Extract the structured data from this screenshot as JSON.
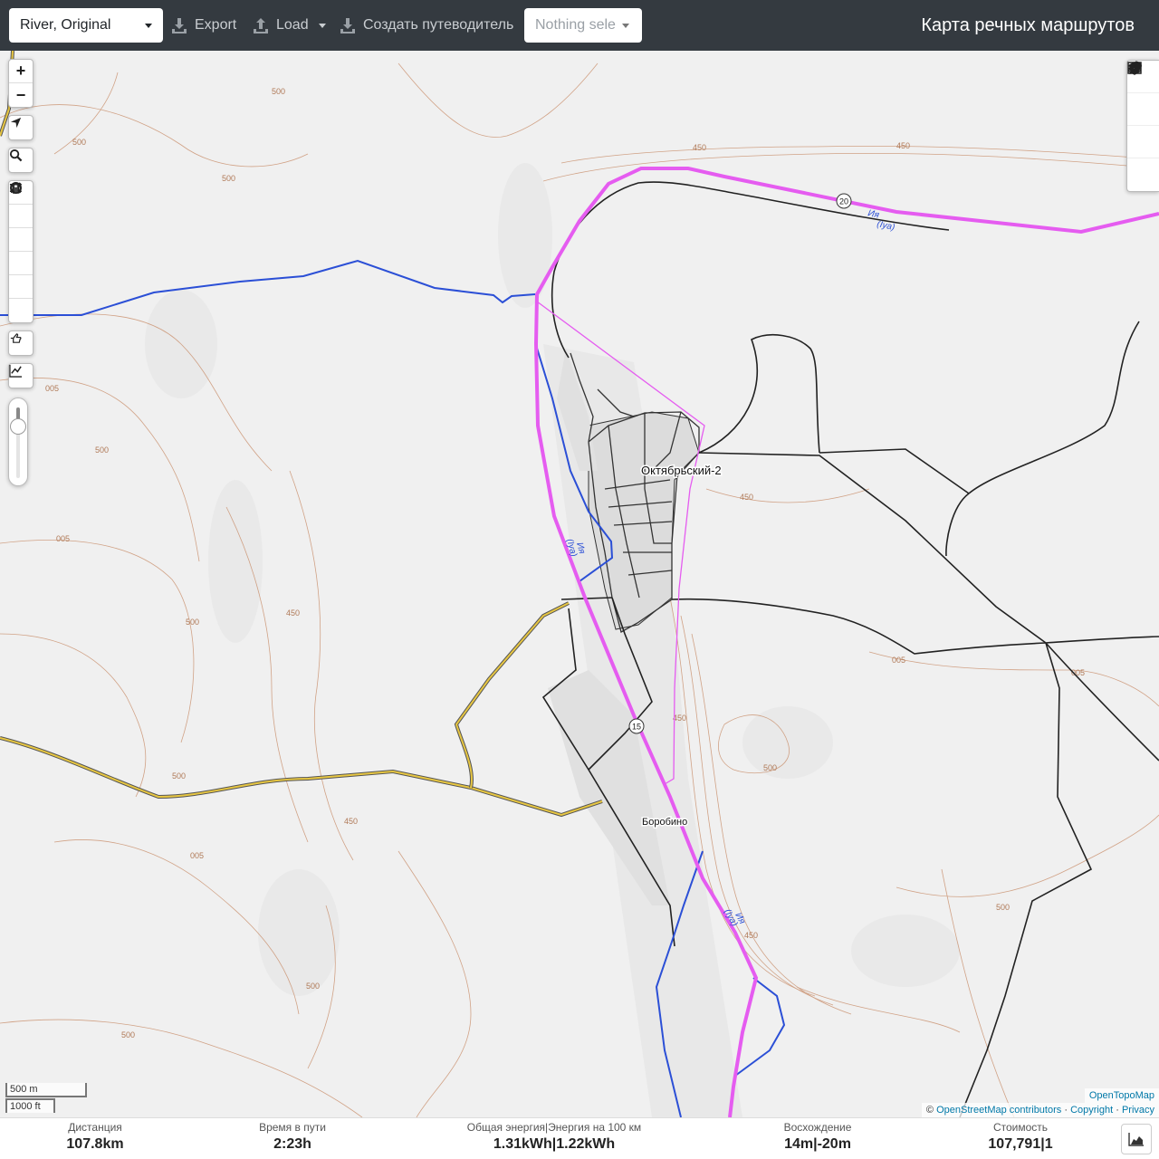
{
  "header": {
    "profile_select": "River, Original",
    "export_label": "Export",
    "load_label": "Load",
    "guide_label": "Создать путеводитель",
    "route_select": "Nothing sele",
    "title": "Карта речных маршрутов"
  },
  "map_controls": {
    "zoom_in": "+",
    "zoom_out": "−"
  },
  "map_labels": {
    "town_main": "Октябрьский-2",
    "town_second": "Боробино",
    "river_name": "Ия",
    "river_name_latin": "(Iya)",
    "road_shield_20": "20",
    "road_shield_15": "15",
    "contour_500": "500",
    "contour_450": "450",
    "contour_005": "005"
  },
  "scale": {
    "metric": "500 m",
    "imperial": "1000 ft"
  },
  "attribution": {
    "opentopomap": "OpenTopoMap",
    "osm_prefix": "©",
    "osm": "OpenStreetMap contributors",
    "sep1": "·",
    "copyright": "Copyright",
    "sep2": "·",
    "privacy": "Privacy"
  },
  "stats": {
    "distance": {
      "label": "Дистанция",
      "value": "107.8km"
    },
    "time": {
      "label": "Время в пути",
      "value": "2:23h"
    },
    "energy": {
      "label": "Общая энергия|Энергия на 100 км",
      "value": "1.31kWh|1.22kWh"
    },
    "ascent": {
      "label": "Восхождение",
      "value": "14m|-20m"
    },
    "cost": {
      "label": "Стоимость",
      "value": "107,791|1"
    }
  },
  "colors": {
    "navbar": "#343a40",
    "route": "#e55cf0",
    "river": "#2b4fd6",
    "contour": "#c98f6c",
    "road_yellow": "#d4b22c"
  }
}
